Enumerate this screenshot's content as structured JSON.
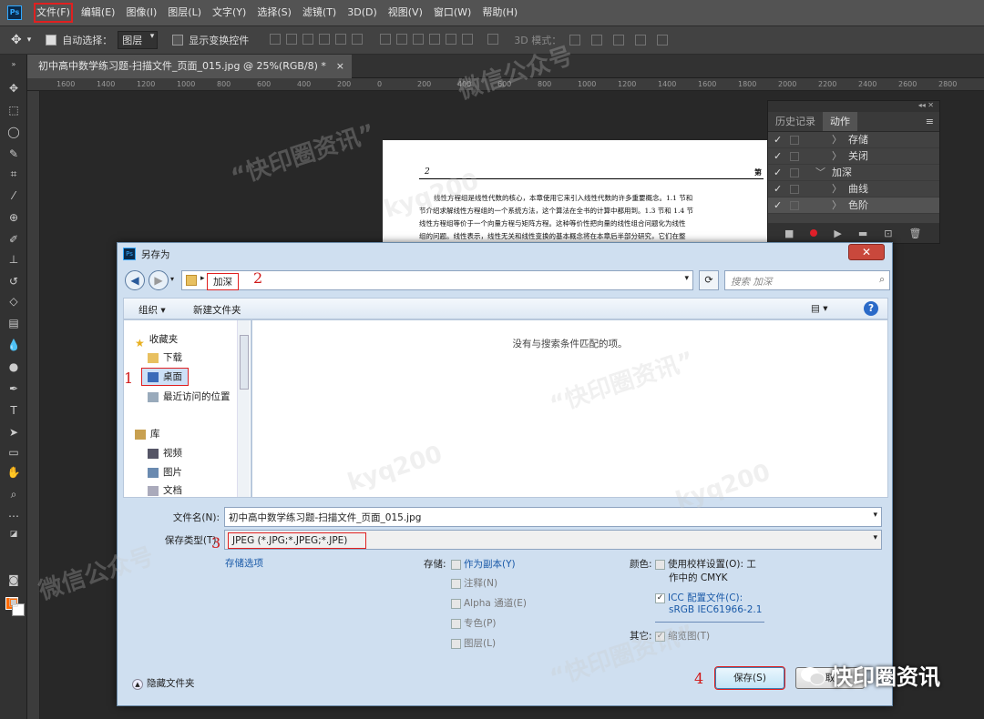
{
  "menubar": {
    "logo": "Ps",
    "items": [
      "文件(F)",
      "编辑(E)",
      "图像(I)",
      "图层(L)",
      "文字(Y)",
      "选择(S)",
      "滤镜(T)",
      "3D(D)",
      "视图(V)",
      "窗口(W)",
      "帮助(H)"
    ]
  },
  "options": {
    "auto_select_label": "自动选择：",
    "auto_select_value": "图层",
    "show_transform_label": "显示变换控件",
    "mode_3d_label": "3D 模式："
  },
  "doc_tab": {
    "title": "初中高中数学练习题-扫描文件_页面_015.jpg @ 25%(RGB/8) *",
    "close": "×"
  },
  "ruler_ticks": [
    "1600",
    "1400",
    "1200",
    "1000",
    "800",
    "600",
    "400",
    "200",
    "0",
    "200",
    "400",
    "600",
    "800",
    "1000",
    "1200",
    "1400",
    "1600",
    "1800",
    "2000",
    "2200",
    "2400",
    "2600",
    "2800"
  ],
  "document": {
    "page_number": "2",
    "right_mark": "第",
    "lines": [
      "线性方程组是线性代数的核心，本章使用它来引入线性代数的许多重要概念。1.1 节和",
      "节介绍求解线性方程组的一个系统方法，这个算法在全书的计算中都用到。1.3 节和 1.4 节",
      "线性方程组等价于一个向量方程与矩阵方程。这种等价性把向量的线性组合问题化为线性",
      "组的问题。线性表示，线性无关和线性变换的基本概念将在本章后半部分研究，它们在整"
    ]
  },
  "actions_panel": {
    "tabs": [
      "历史记录",
      "动作"
    ],
    "active_tab": "动作",
    "rows": [
      {
        "label": "存储",
        "indent": 2,
        "arrow": "〉"
      },
      {
        "label": "关闭",
        "indent": 2,
        "arrow": "〉"
      },
      {
        "label": "加深",
        "indent": 1,
        "arrow": "﹀"
      },
      {
        "label": "曲线",
        "indent": 2,
        "arrow": "〉"
      },
      {
        "label": "色阶",
        "indent": 2,
        "arrow": "〉"
      }
    ]
  },
  "dialog": {
    "title": "另存为",
    "close": "✕",
    "breadcrumb": "加深",
    "search_placeholder": "搜索 加深",
    "organize": "组织 ▾",
    "new_folder": "新建文件夹",
    "nav": {
      "favorites": "收藏夹",
      "downloads": "下载",
      "desktop": "桌面",
      "recent": "最近访问的位置",
      "libraries": "库",
      "videos": "视频",
      "pictures": "图片",
      "documents": "文档"
    },
    "empty_message": "没有与搜索条件匹配的项。",
    "filename_label": "文件名(N):",
    "filename_value": "初中高中数学练习题-扫描文件_页面_015.jpg",
    "filetype_label": "保存类型(T):",
    "filetype_value": "JPEG (*.JPG;*.JPEG;*.JPE)",
    "save_options_link": "存储选项",
    "storage_label": "存储:",
    "storage_options": [
      "作为副本(Y)",
      "注释(N)",
      "Alpha 通道(E)",
      "专色(P)",
      "图层(L)"
    ],
    "color_label": "颜色:",
    "proof_setup": "使用校样设置(O): 工",
    "proof_setup_2": "作中的 CMYK",
    "icc_label": "ICC 配置文件(C):",
    "icc_value": "sRGB IEC61966-2.1",
    "other_label": "其它:",
    "thumbnail": "缩览图(T)",
    "hide_folders": "隐藏文件夹",
    "save_button": "保存(S)",
    "cancel_button": "取"
  },
  "annotations": [
    "1",
    "2",
    "3",
    "4"
  ],
  "watermarks": [
    "“快印圈资讯”",
    "微信公众号",
    "kyq200"
  ],
  "brand": "快印圈资讯",
  "colors": {
    "accent_red": "#e02020",
    "foreground_swatch": "#ff6a00",
    "ps_blue": "#31a8ff"
  }
}
